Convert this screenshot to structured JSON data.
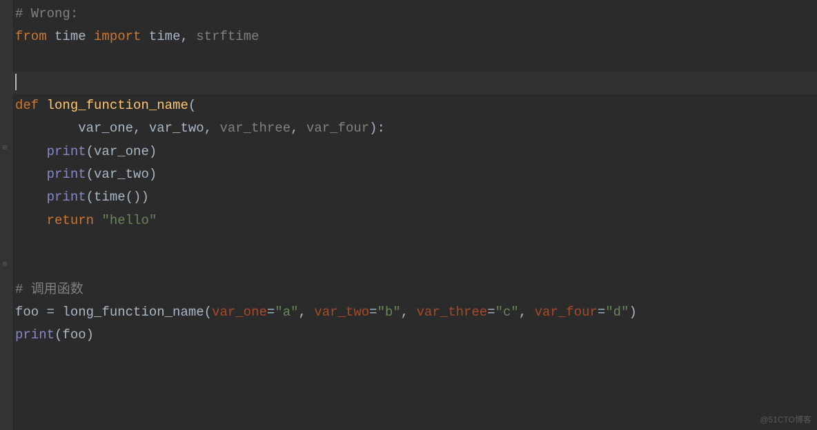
{
  "code": {
    "line1_comment": "# Wrong:",
    "line2_from": "from",
    "line2_mod": "time",
    "line2_import": "import",
    "line2_name1": "time",
    "line2_comma": ", ",
    "line2_name2": "strftime",
    "line5_def": "def",
    "line5_fname": "long_function_name",
    "line5_open": "(",
    "line6_indent": "        ",
    "line6_p1": "var_one",
    "line6_c1": ", ",
    "line6_p2": "var_two",
    "line6_c2": ", ",
    "line6_p3": "var_three",
    "line6_c3": ", ",
    "line6_p4": "var_four",
    "line6_close": "):",
    "line7_indent": "    ",
    "line7_print": "print",
    "line7_open": "(",
    "line7_arg": "var_one",
    "line7_close": ")",
    "line8_indent": "    ",
    "line8_print": "print",
    "line8_open": "(",
    "line8_arg": "var_two",
    "line8_close": ")",
    "line9_indent": "    ",
    "line9_print": "print",
    "line9_open": "(",
    "line9_call": "time",
    "line9_inner": "()",
    "line9_close": ")",
    "line10_indent": "    ",
    "line10_return": "return",
    "line10_sp": " ",
    "line10_str": "\"hello\"",
    "line13_comment": "# 调用函数",
    "line14_var": "foo ",
    "line14_eq": "= ",
    "line14_fn": "long_function_name",
    "line14_open": "(",
    "line14_k1": "var_one",
    "line14_e1": "=",
    "line14_v1": "\"a\"",
    "line14_c1": ", ",
    "line14_k2": "var_two",
    "line14_e2": "=",
    "line14_v2": "\"b\"",
    "line14_c2": ", ",
    "line14_k3": "var_three",
    "line14_e3": "=",
    "line14_v3": "\"c\"",
    "line14_c3": ", ",
    "line14_k4": "var_four",
    "line14_e4": "=",
    "line14_v4": "\"d\"",
    "line14_close": ")",
    "line15_print": "print",
    "line15_open": "(",
    "line15_arg": "foo",
    "line15_close": ")"
  },
  "watermark": "@51CTO博客"
}
